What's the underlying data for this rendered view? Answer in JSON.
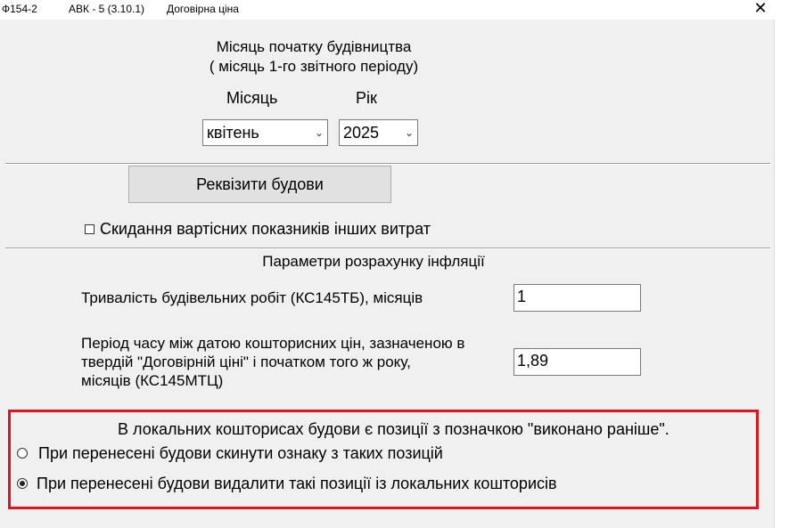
{
  "titlebar": {
    "form_code": "Ф154-2",
    "app_version": "АВК - 5 (3.10.1)",
    "window_title": "Договірна ціна",
    "close_glyph": "✕"
  },
  "start_month": {
    "heading_line1": "Місяць початку будівництва",
    "heading_line2": "( місяць 1-го звітного періоду)",
    "month_label": "Місяць",
    "year_label": "Рік",
    "month_value": "квітень",
    "year_value": "2025"
  },
  "requisites_button": "Реквізити будови",
  "reset_checkbox": {
    "label": "Скидання вартісних показників інших витрат",
    "checked": false
  },
  "inflation": {
    "heading": "Параметри розрахунку інфляції",
    "duration_label": "Тривалість будівельних робіт (КС145ТБ), місяців",
    "duration_value": "1",
    "period_label_line1": "Період часу між датою кошторисних цін, зазначеною в",
    "period_label_line2": "твердій \"Договірній ціні\" і початком того ж року,",
    "period_label_line3": "місяців  (КС145МТЦ)",
    "period_value": "1,89"
  },
  "earlier_positions": {
    "notice": "В локальних кошторисах будови є позиції з позначкою \"виконано раніше\".",
    "options": [
      {
        "label": "При перенесені будови скинути ознаку з таких позицій",
        "selected": false
      },
      {
        "label": "При перенесені будови  видалити такі позиції із локальних кошторисів",
        "selected": true
      }
    ]
  },
  "icons": {
    "dropdown": "chevron-down-icon",
    "close": "close-icon"
  },
  "colors": {
    "highlight_border": "#e0141c",
    "window_bg": "#f0f0f0"
  }
}
